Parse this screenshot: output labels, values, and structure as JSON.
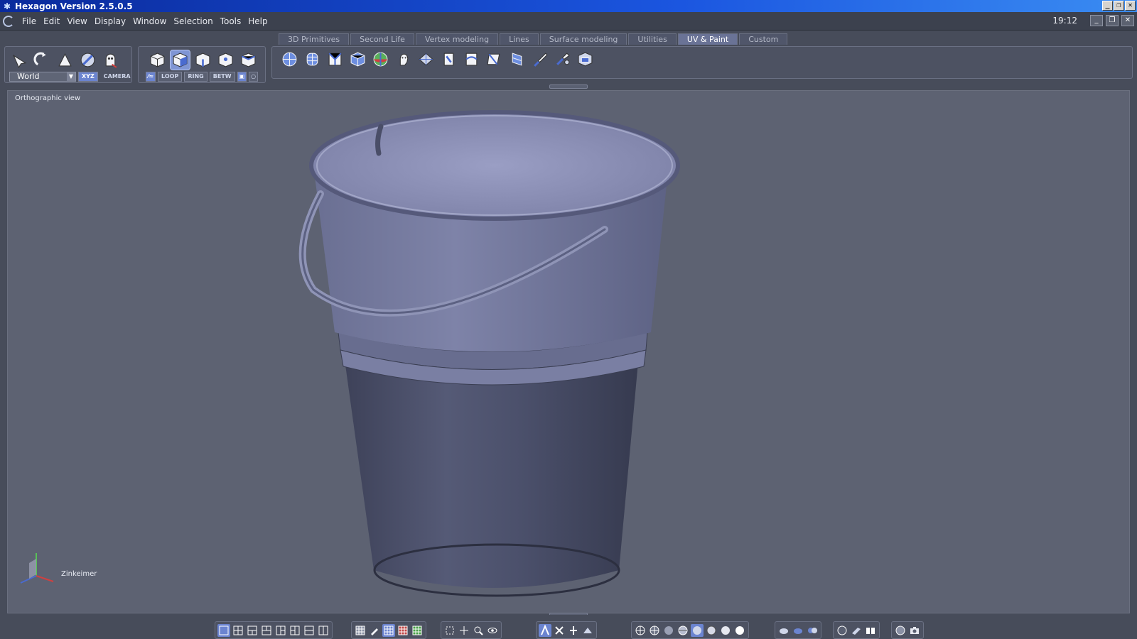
{
  "window": {
    "title": "Hexagon Version 2.5.0.5",
    "buttons": [
      "_",
      "❐",
      "✕"
    ]
  },
  "menu": {
    "items": [
      "File",
      "Edit",
      "View",
      "Display",
      "Window",
      "Selection",
      "Tools",
      "Help"
    ],
    "clock": "19:12",
    "mdi_buttons": [
      "_",
      "❐",
      "✕"
    ]
  },
  "tabs": [
    {
      "label": "3D Primitives",
      "active": false
    },
    {
      "label": "Second Life",
      "active": false
    },
    {
      "label": "Vertex modeling",
      "active": false
    },
    {
      "label": "Lines",
      "active": false
    },
    {
      "label": "Surface modeling",
      "active": false
    },
    {
      "label": "Utilities",
      "active": false
    },
    {
      "label": "UV & Paint",
      "active": true
    },
    {
      "label": "Custom",
      "active": false
    }
  ],
  "toolbar": {
    "coord_system": "World",
    "coord_buttons": [
      "XYZ",
      "CAMERA"
    ],
    "select_buttons": [
      "LOOP",
      "RING",
      "BETW"
    ]
  },
  "viewport": {
    "label": "Orthographic view",
    "object_name": "Zinkeimer"
  },
  "colors": {
    "accent": "#6b84d0",
    "titlebar": "#1b56e0",
    "viewport_bg": "#5d6272",
    "bucket": "#4f5470"
  }
}
